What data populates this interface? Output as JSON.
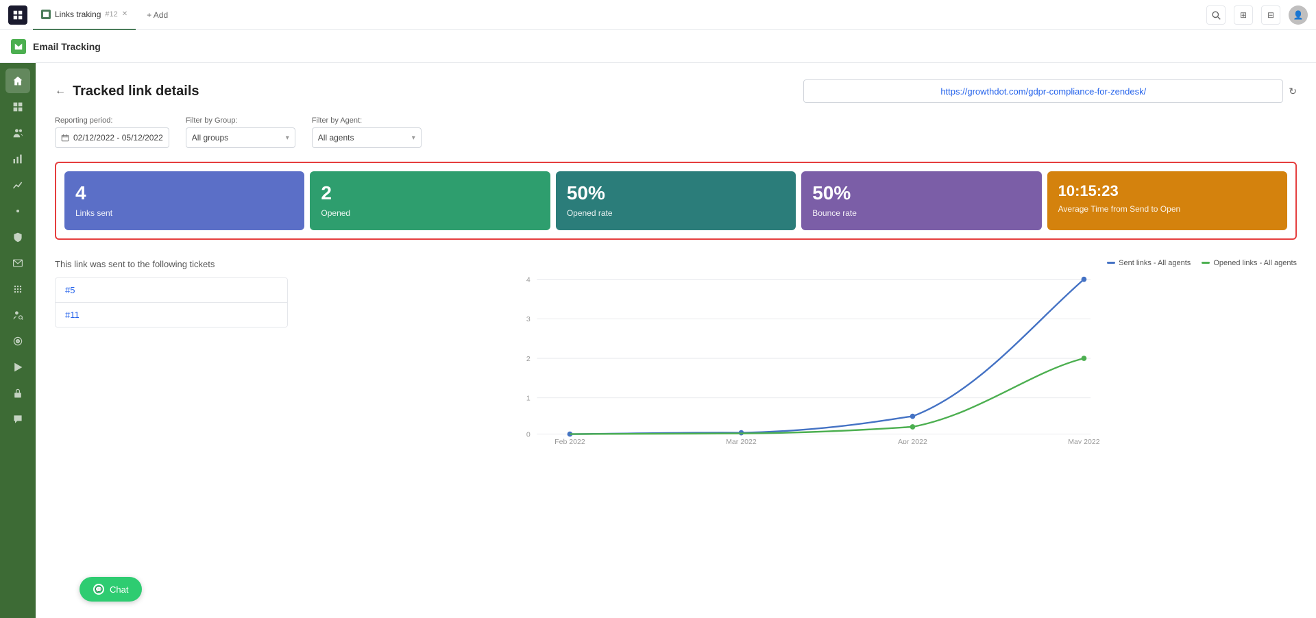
{
  "topbar": {
    "tab_title": "Links traking",
    "tab_subtitle": "#12",
    "add_label": "+ Add"
  },
  "appbar": {
    "title": "Email Tracking"
  },
  "page": {
    "title": "Tracked link details",
    "url": "https://growthdot.com/gdpr-compliance-for-zendesk/"
  },
  "filters": {
    "reporting_period_label": "Reporting period:",
    "reporting_period_value": "02/12/2022 - 05/12/2022",
    "group_label": "Filter by Group:",
    "group_value": "All groups",
    "agent_label": "Filter by Agent:",
    "agent_value": "All agents"
  },
  "stats": [
    {
      "value": "4",
      "label": "Links sent",
      "color_class": "stat-blue"
    },
    {
      "value": "2",
      "label": "Opened",
      "color_class": "stat-green"
    },
    {
      "value": "50%",
      "label": "Opened rate",
      "color_class": "stat-teal"
    },
    {
      "value": "50%",
      "label": "Bounce rate",
      "color_class": "stat-purple"
    },
    {
      "value": "10:15:23",
      "label": "Average Time from Send to Open",
      "color_class": "stat-orange"
    }
  ],
  "tickets_panel": {
    "title": "This link was sent to the following tickets",
    "tickets": [
      "#5",
      "#11"
    ]
  },
  "chart": {
    "legend_sent": "Sent links - All agents",
    "legend_opened": "Opened links - All agents",
    "x_labels": [
      "Feb 2022",
      "Mar 2022",
      "Apr 2022",
      "May 2022"
    ],
    "y_labels": [
      "0",
      "1",
      "2",
      "3",
      "4"
    ],
    "sent_color": "#4472c4",
    "opened_color": "#4caf50"
  },
  "chat": {
    "label": "Chat"
  },
  "sidebar": {
    "items": [
      {
        "icon": "home",
        "label": "home"
      },
      {
        "icon": "dashboard",
        "label": "dashboard"
      },
      {
        "icon": "people",
        "label": "people"
      },
      {
        "icon": "chart-bar",
        "label": "chart-bar"
      },
      {
        "icon": "chart-line",
        "label": "chart-line"
      },
      {
        "icon": "settings",
        "label": "settings"
      },
      {
        "icon": "shield",
        "label": "shield"
      },
      {
        "icon": "email",
        "label": "email"
      },
      {
        "icon": "grid",
        "label": "grid"
      },
      {
        "icon": "person-search",
        "label": "person-search"
      },
      {
        "icon": "circle",
        "label": "circle"
      },
      {
        "icon": "play",
        "label": "play"
      },
      {
        "icon": "lock",
        "label": "lock"
      },
      {
        "icon": "chat",
        "label": "chat"
      }
    ]
  }
}
